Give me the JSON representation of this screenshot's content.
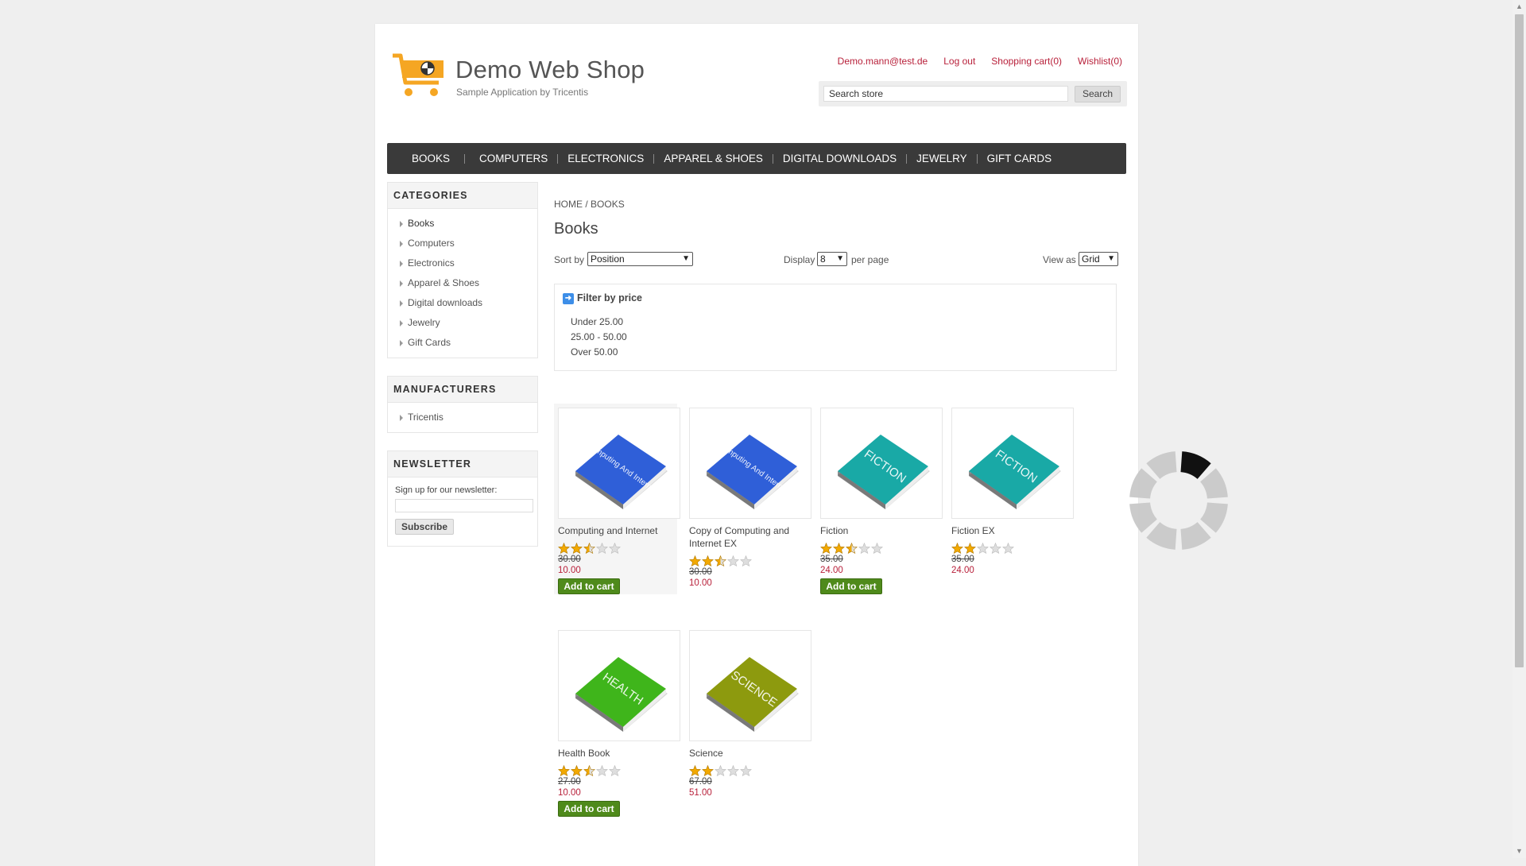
{
  "header": {
    "title": "Demo Web Shop",
    "subtitle": "Sample Application by Tricentis",
    "links": {
      "account": "Demo.mann@test.de",
      "logout": "Log out",
      "cart": "Shopping cart(0)",
      "wishlist": "Wishlist(0)"
    },
    "search": {
      "value": "Search store",
      "button": "Search"
    }
  },
  "top_menu": [
    "BOOKS",
    "COMPUTERS",
    "ELECTRONICS",
    "APPAREL & SHOES",
    "DIGITAL DOWNLOADS",
    "JEWELRY",
    "GIFT CARDS"
  ],
  "sidebar": {
    "categories": {
      "title": "CATEGORIES",
      "items": [
        "Books",
        "Computers",
        "Electronics",
        "Apparel & Shoes",
        "Digital downloads",
        "Jewelry",
        "Gift Cards"
      ]
    },
    "manufacturers": {
      "title": "MANUFACTURERS",
      "items": [
        "Tricentis"
      ]
    },
    "newsletter": {
      "title": "NEWSLETTER",
      "label": "Sign up for our newsletter:",
      "button": "Subscribe"
    }
  },
  "main": {
    "breadcrumb": {
      "home": "HOME",
      "sep": " / ",
      "current": "BOOKS"
    },
    "title": "Books",
    "sort": {
      "label": "Sort by",
      "value": "Position"
    },
    "display": {
      "label": "Display",
      "value": "8",
      "suffix": "per page"
    },
    "view": {
      "label": "View as",
      "value": "Grid"
    },
    "filter": {
      "title": "Filter by price",
      "options": [
        "Under 25.00",
        "25.00 - 50.00",
        "Over 50.00"
      ]
    },
    "add_to_cart_label": "Add to cart",
    "products": [
      {
        "title": "Computing and Internet",
        "rating": 2.5,
        "old_price": "30.00",
        "price": "10.00",
        "cover": "Computing And Internet",
        "cover_color": "#2f5fd8",
        "has_add": true
      },
      {
        "title": "Copy of Computing and Internet EX",
        "rating": 2.5,
        "old_price": "30.00",
        "price": "10.00",
        "cover": "Computing And Internet",
        "cover_color": "#2f5fd8",
        "has_add": false
      },
      {
        "title": "Fiction",
        "rating": 2.5,
        "old_price": "35.00",
        "price": "24.00",
        "cover": "FICTION",
        "cover_color": "#19a9a6",
        "has_add": true
      },
      {
        "title": "Fiction EX",
        "rating": 2,
        "old_price": "35.00",
        "price": "24.00",
        "cover": "FICTION",
        "cover_color": "#19a9a6",
        "has_add": false
      },
      {
        "title": "Health Book",
        "rating": 2.5,
        "old_price": "27.00",
        "price": "10.00",
        "cover": "HEALTH",
        "cover_color": "#3fb51b",
        "has_add": true
      },
      {
        "title": "Science",
        "rating": 2,
        "old_price": "67.00",
        "price": "51.00",
        "cover": "SCIENCE",
        "cover_color": "#8d9a0e",
        "has_add": false
      }
    ]
  },
  "colors": {
    "link": "#b8203a",
    "menu_bg": "#3a3a3a",
    "add_to_cart": "#4f8a1b",
    "logo": "#f5a623"
  }
}
